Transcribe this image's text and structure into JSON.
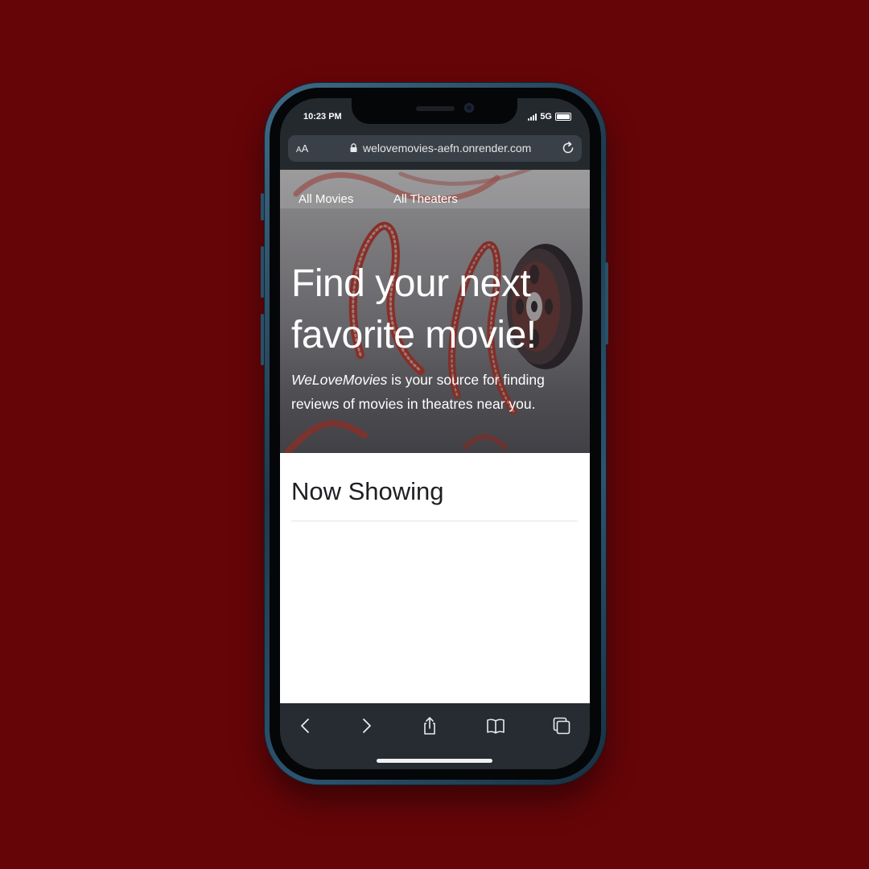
{
  "status_bar": {
    "time": "10:23 PM",
    "network": "5G"
  },
  "browser": {
    "text_size_label_small": "A",
    "text_size_label_large": "A",
    "url": "welovemovies-aefn.onrender.com"
  },
  "nav": {
    "items": [
      {
        "label": "All Movies"
      },
      {
        "label": "All Theaters"
      }
    ]
  },
  "hero": {
    "headline": "Find your next favorite movie!",
    "brand": "WeLoveMovies",
    "tagline_rest": " is your source for finding reviews of movies in theatres near you."
  },
  "section": {
    "title": "Now Showing"
  },
  "toolbar": {
    "icons": [
      "back-icon",
      "forward-icon",
      "share-icon",
      "bookmarks-icon",
      "tabs-icon"
    ]
  },
  "colors": {
    "background": "#660508",
    "film_red": "#c0392b",
    "toolbar": "#262c31"
  }
}
